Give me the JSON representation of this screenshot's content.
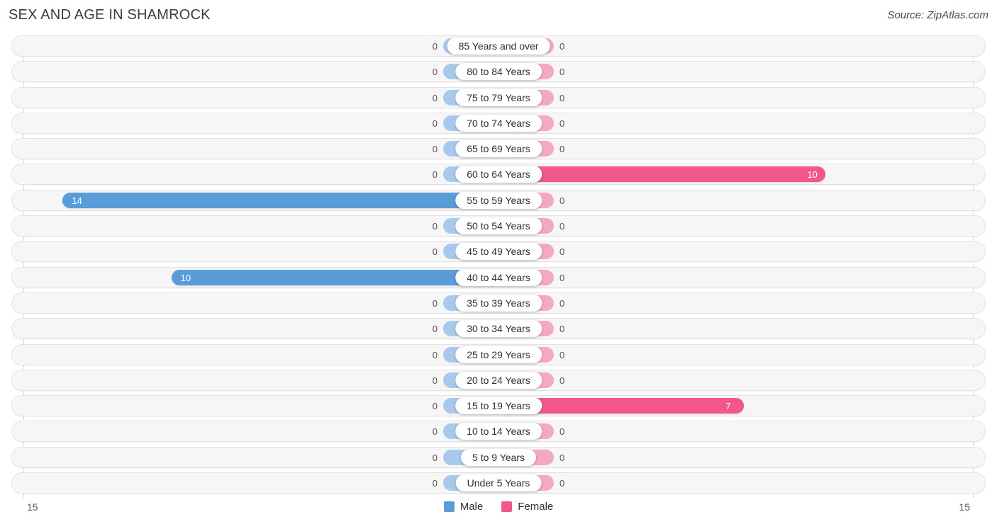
{
  "header": {
    "title": "SEX AND AGE IN SHAMROCK",
    "source": "Source: ZipAtlas.com"
  },
  "axis": {
    "left_tick": "15",
    "right_tick": "15",
    "max": 15
  },
  "legend": {
    "male_label": "Male",
    "female_label": "Female",
    "male_color": "#5a9bd9",
    "female_color": "#f1568c"
  },
  "colors": {
    "male": "#5a9bd9",
    "female": "#f1568c",
    "male_zero": "#a9c9ec",
    "female_zero": "#f5a8c3",
    "row_background": "#f6f6f6",
    "row_border": "#e3e3e3",
    "axis_line": "#dcdcdc"
  },
  "chart_data": {
    "type": "bar",
    "title": "SEX AND AGE IN SHAMROCK",
    "subtitle": "Source: ZipAtlas.com",
    "xlabel": "",
    "ylabel": "",
    "orientation": "horizontal",
    "layout": "population-pyramid",
    "legend_position": "bottom-center",
    "grid": false,
    "xlim": [
      15,
      15
    ],
    "axis_max": 15,
    "categories": [
      "85 Years and over",
      "80 to 84 Years",
      "75 to 79 Years",
      "70 to 74 Years",
      "65 to 69 Years",
      "60 to 64 Years",
      "55 to 59 Years",
      "50 to 54 Years",
      "45 to 49 Years",
      "40 to 44 Years",
      "35 to 39 Years",
      "30 to 34 Years",
      "25 to 29 Years",
      "20 to 24 Years",
      "15 to 19 Years",
      "10 to 14 Years",
      "5 to 9 Years",
      "Under 5 Years"
    ],
    "series": [
      {
        "name": "Male",
        "color": "#5a9bd9",
        "values": [
          0,
          0,
          0,
          0,
          0,
          0,
          14,
          0,
          0,
          10,
          0,
          0,
          0,
          0,
          0,
          0,
          0,
          0
        ]
      },
      {
        "name": "Female",
        "color": "#f1568c",
        "values": [
          0,
          0,
          0,
          0,
          0,
          10,
          0,
          0,
          0,
          0,
          0,
          0,
          0,
          0,
          7,
          0,
          0,
          0
        ]
      }
    ]
  },
  "rows": [
    {
      "age": "85 Years and over",
      "male": "0",
      "female": "0"
    },
    {
      "age": "80 to 84 Years",
      "male": "0",
      "female": "0"
    },
    {
      "age": "75 to 79 Years",
      "male": "0",
      "female": "0"
    },
    {
      "age": "70 to 74 Years",
      "male": "0",
      "female": "0"
    },
    {
      "age": "65 to 69 Years",
      "male": "0",
      "female": "0"
    },
    {
      "age": "60 to 64 Years",
      "male": "0",
      "female": "10"
    },
    {
      "age": "55 to 59 Years",
      "male": "14",
      "female": "0"
    },
    {
      "age": "50 to 54 Years",
      "male": "0",
      "female": "0"
    },
    {
      "age": "45 to 49 Years",
      "male": "0",
      "female": "0"
    },
    {
      "age": "40 to 44 Years",
      "male": "10",
      "female": "0"
    },
    {
      "age": "35 to 39 Years",
      "male": "0",
      "female": "0"
    },
    {
      "age": "30 to 34 Years",
      "male": "0",
      "female": "0"
    },
    {
      "age": "25 to 29 Years",
      "male": "0",
      "female": "0"
    },
    {
      "age": "20 to 24 Years",
      "male": "0",
      "female": "0"
    },
    {
      "age": "15 to 19 Years",
      "male": "0",
      "female": "7"
    },
    {
      "age": "10 to 14 Years",
      "male": "0",
      "female": "0"
    },
    {
      "age": "5 to 9 Years",
      "male": "0",
      "female": "0"
    },
    {
      "age": "Under 5 Years",
      "male": "0",
      "female": "0"
    }
  ]
}
